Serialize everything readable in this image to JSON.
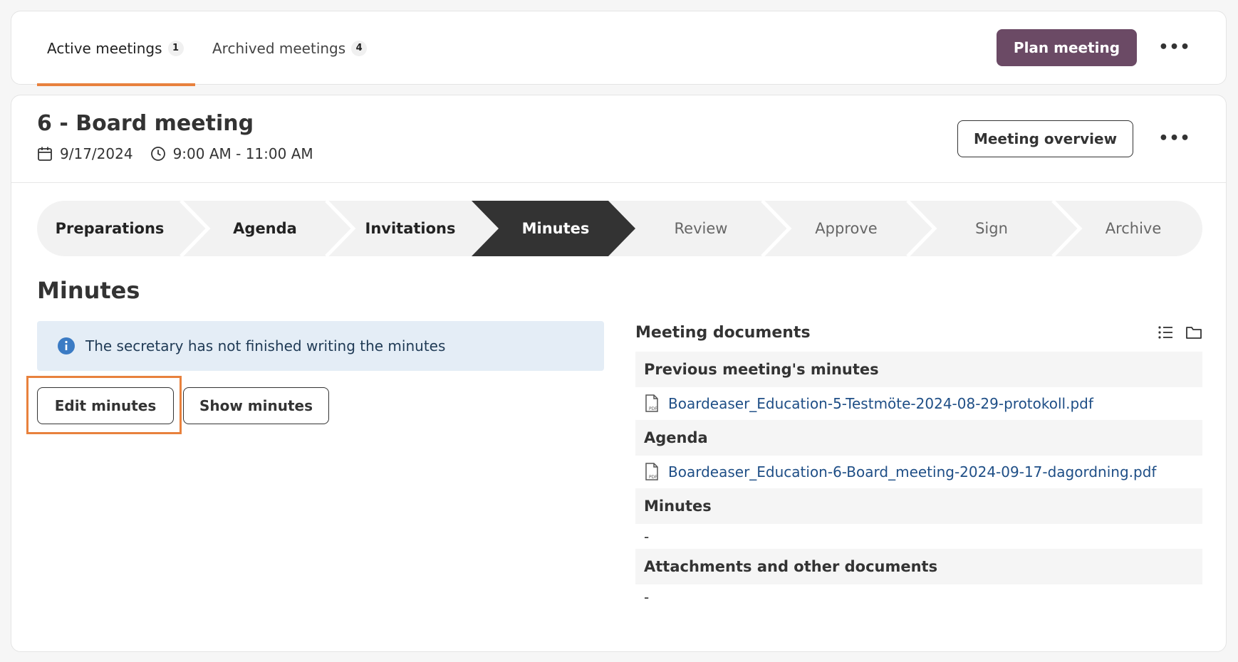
{
  "tabs": [
    {
      "label": "Active meetings",
      "count": "1"
    },
    {
      "label": "Archived meetings",
      "count": "4"
    }
  ],
  "top_actions": {
    "plan_meeting": "Plan meeting",
    "more": "•••"
  },
  "meeting": {
    "title": "6 - Board meeting",
    "date": "9/17/2024",
    "time": "9:00 AM - 11:00 AM",
    "overview_button": "Meeting overview",
    "more": "•••"
  },
  "steps": [
    "Preparations",
    "Agenda",
    "Invitations",
    "Minutes",
    "Review",
    "Approve",
    "Sign",
    "Archive"
  ],
  "current_step": "Minutes",
  "section_title": "Minutes",
  "info_message": "The secretary has not finished writing the minutes",
  "buttons": {
    "edit_minutes": "Edit minutes",
    "show_minutes": "Show minutes"
  },
  "documents": {
    "title": "Meeting documents",
    "sections": [
      {
        "heading": "Previous meeting's minutes",
        "files": [
          "Boardeaser_Education-5-Testmöte-2024-08-29-protokoll.pdf"
        ]
      },
      {
        "heading": "Agenda",
        "files": [
          "Boardeaser_Education-6-Board_meeting-2024-09-17-dagordning.pdf"
        ]
      },
      {
        "heading": "Minutes",
        "empty": "-"
      },
      {
        "heading": "Attachments and other documents",
        "empty": "-"
      }
    ]
  },
  "colors": {
    "accent": "#e8813d",
    "primary": "#6b4a65",
    "step_current": "#333333",
    "step_bg": "#f2f2f2",
    "link": "#1e4e86"
  },
  "icons": {
    "date": "calendar-icon",
    "time": "clock-icon",
    "info": "info-icon",
    "list_view": "list-view-icon",
    "folder_view": "folder-icon",
    "file": "pdf-file-icon"
  }
}
